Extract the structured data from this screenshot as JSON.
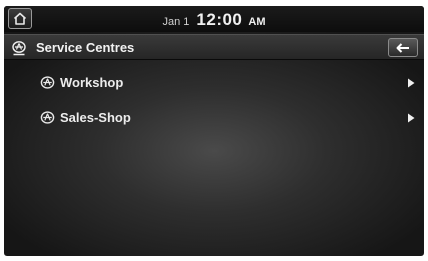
{
  "status": {
    "date": "Jan 1",
    "time": "12:00",
    "ampm": "AM"
  },
  "header": {
    "title": "Service Centres",
    "home_icon": "home-icon",
    "back_icon": "back-arrow-icon"
  },
  "list": {
    "items": [
      {
        "label": "Workshop",
        "icon": "service-centre-icon"
      },
      {
        "label": "Sales-Shop",
        "icon": "service-centre-icon"
      }
    ]
  },
  "colors": {
    "background": "#2e2e2e",
    "text": "#ececec"
  }
}
